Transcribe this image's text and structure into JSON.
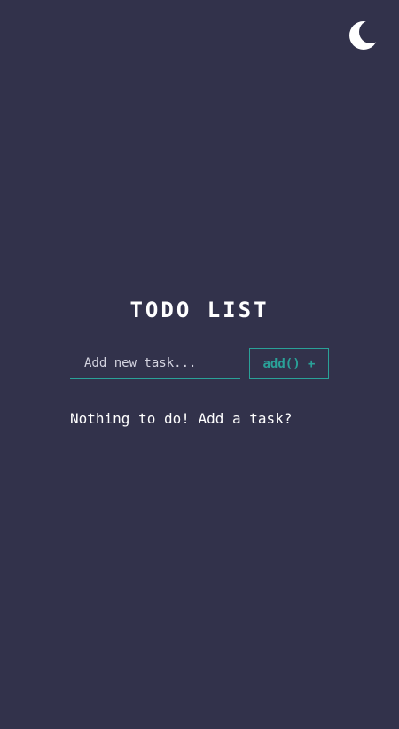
{
  "theme_toggle": {
    "icon": "moon-icon"
  },
  "header": {
    "title": "TODO LIST"
  },
  "form": {
    "input_placeholder": "Add new task...",
    "input_value": "",
    "add_label": "add() +"
  },
  "list": {
    "empty_message": "Nothing to do! Add a task?"
  },
  "colors": {
    "background": "#32324b",
    "accent": "#2aa198",
    "text": "#ffffff"
  }
}
